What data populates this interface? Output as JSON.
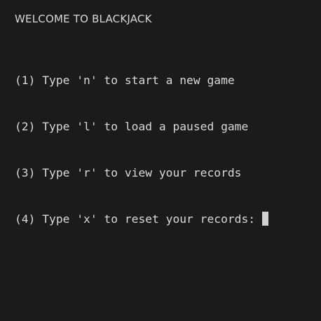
{
  "terminal": {
    "title": "WELCOME TO BLACKJACK",
    "options": [
      "(1) Type 'n' to start a new game",
      "(2) Type 'l' to load a paused game",
      "(3) Type 'r' to view your records",
      "(4) Type 'x' to reset your records: "
    ],
    "colors": {
      "background": "#1b1b1b",
      "text": "#d8d8d8",
      "cursor": "#d0d0d0"
    }
  }
}
